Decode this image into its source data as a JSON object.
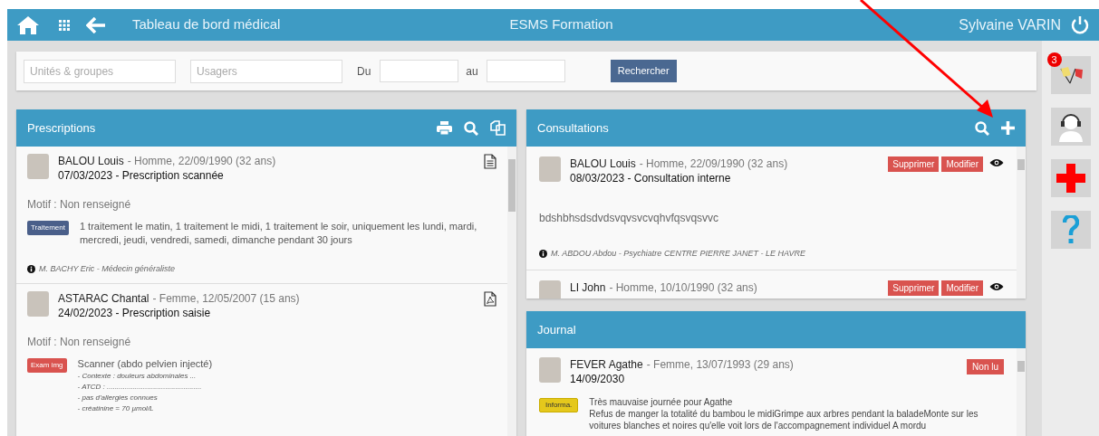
{
  "header": {
    "title": "Tableau de bord médical",
    "center_title": "ESMS Formation",
    "user": "Sylvaine VARIN"
  },
  "filters": {
    "fields": [
      {
        "placeholder": "Unités & groupes"
      },
      {
        "placeholder": "Usagers"
      }
    ],
    "from_label": "Du",
    "to_label": "au",
    "search_button": "Rechercher"
  },
  "prescriptions": {
    "title": "Prescriptions",
    "items": [
      {
        "name": "BALOU Louis",
        "details": "- Homme, 22/09/1990 (32 ans)",
        "heading": "07/03/2023 - Prescription scannée",
        "kind": "text",
        "motif": "Motif : Non renseigné",
        "tag": {
          "label": "Traitement",
          "color": "#4a5f8a"
        },
        "text": "1 traitement le matin, 1 traitement le midi, 1 traitement le soir, uniquement les lundi, mardi, mercredi, jeudi, vendredi, samedi, dimanche pendant 30 jours",
        "author": "M. BACHY Eric - Médecin généraliste"
      },
      {
        "name": "ASTARAC Chantal",
        "details": "- Femme, 12/05/2007 (15 ans)",
        "heading": "24/02/2023 - Prescription saisie",
        "kind": "pdf",
        "motif": "Motif : Non renseigné",
        "tag": {
          "label": "Exam img",
          "color": "#d9534f"
        },
        "text": "Scanner (abdo pelvien injecté)",
        "notes": [
          "- Contexte : douleurs abdominales ...",
          "- ATCD : ...............................................",
          "- pas d'allergies connues",
          "- créatinine = 70 µmol/L"
        ]
      }
    ]
  },
  "consultations": {
    "title": "Consultations",
    "items": [
      {
        "name": "BALOU Louis",
        "details": "- Homme, 22/09/1990 (32 ans)",
        "heading": "08/03/2023 - Consultation interne",
        "body": "bdshbhsdsdvdsvqvsvcvqhvfqsvqsvvc",
        "author": "M. ABDOU Abdou - Psychiatre CENTRE PIERRE JANET - LE HAVRE",
        "actions": [
          "Supprimer",
          "Modifier"
        ]
      },
      {
        "name": "LI John",
        "details": "- Homme, 10/10/1990 (32 ans)",
        "actions": [
          "Supprimer",
          "Modifier"
        ]
      }
    ]
  },
  "journal": {
    "title": "Journal",
    "items": [
      {
        "name": "FEVER Agathe",
        "details": "- Femme, 13/07/1993 (29 ans)",
        "heading": "14/09/2030",
        "status": "Non lu",
        "tag": {
          "label": "Informa.",
          "color": "#e5c81c"
        },
        "lines": [
          "Très mauvaise journée pour Agathe",
          "Refus de manger la totalité du bambou le midiGrimpe aux arbres pendant la baladeMonte sur les voitures blanches et noires qu'elle voit lors de l'accompagnement individuel A mordu"
        ]
      }
    ]
  },
  "sidebar": {
    "notification_count": "3"
  }
}
